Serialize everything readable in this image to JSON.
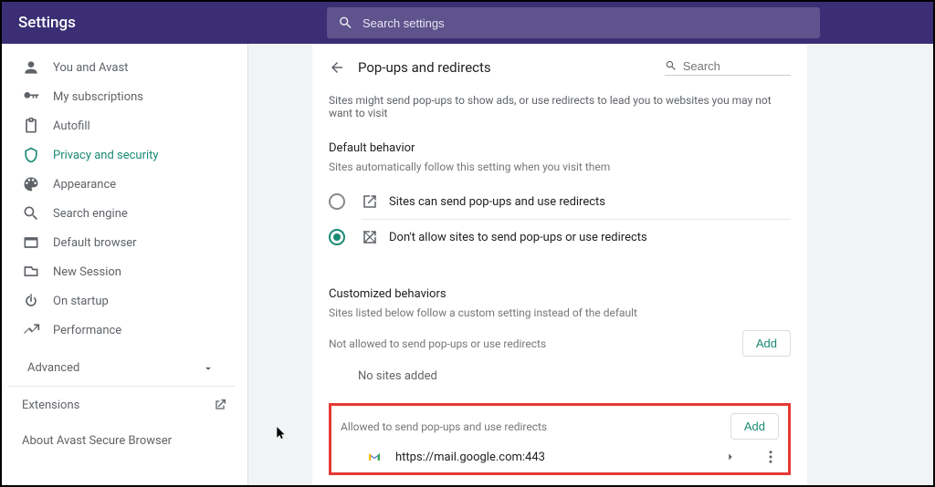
{
  "header": {
    "title": "Settings",
    "search_placeholder": "Search settings"
  },
  "sidebar": {
    "items": [
      {
        "label": "You and Avast"
      },
      {
        "label": "My subscriptions"
      },
      {
        "label": "Autofill"
      },
      {
        "label": "Privacy and security"
      },
      {
        "label": "Appearance"
      },
      {
        "label": "Search engine"
      },
      {
        "label": "Default browser"
      },
      {
        "label": "New Session"
      },
      {
        "label": "On startup"
      },
      {
        "label": "Performance"
      }
    ],
    "advanced": "Advanced",
    "extensions": "Extensions",
    "about": "About Avast Secure Browser"
  },
  "content": {
    "title": "Pop-ups and redirects",
    "search_placeholder": "Search",
    "intro": "Sites might send pop-ups to show ads, or use redirects to lead you to websites you may not want to visit",
    "default_title": "Default behavior",
    "default_sub": "Sites automatically follow this setting when you visit them",
    "opt_allow": "Sites can send pop-ups and use redirects",
    "opt_block": "Don't allow sites to send pop-ups or use redirects",
    "custom_title": "Customized behaviors",
    "custom_sub": "Sites listed below follow a custom setting instead of the default",
    "not_allowed_title": "Not allowed to send pop-ups or use redirects",
    "no_sites": "No sites added",
    "allowed_title": "Allowed to send pop-ups and use redirects",
    "add": "Add",
    "site_url": "https://mail.google.com:443"
  }
}
